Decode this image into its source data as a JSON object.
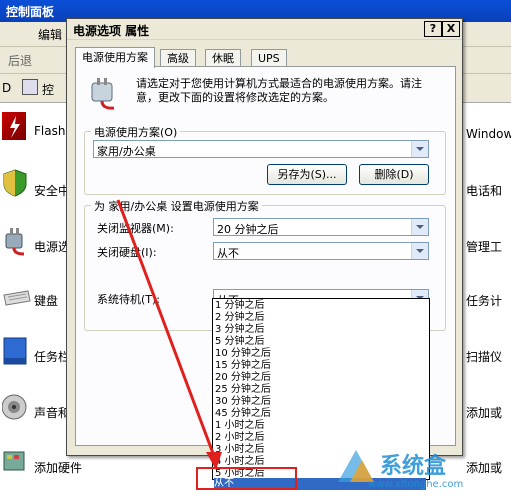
{
  "control_panel": {
    "window_title": "控制面板",
    "menu_partial": "编辑",
    "back_label": "后退",
    "address_partial": "控",
    "address_prefix": "D",
    "left_items": [
      {
        "label": "Flash H",
        "icon": "flash-icon"
      },
      {
        "label": "安全中",
        "icon": "security-shield-icon"
      },
      {
        "label": "电源选",
        "icon": "power-plug-icon"
      },
      {
        "label": "键盘",
        "icon": "keyboard-icon"
      },
      {
        "label": "任务栏",
        "icon": "taskbar-icon"
      },
      {
        "label": "声音和",
        "icon": "speaker-icon"
      },
      {
        "label": "添加硬件",
        "icon": "hardware-icon"
      }
    ],
    "right_items": [
      "Window",
      "电话和",
      "管理工",
      "任务计",
      "扫描仪",
      "添加或",
      "添加或"
    ]
  },
  "dialog": {
    "title": "电源选项 属性",
    "help_button": "?",
    "close_button": "X",
    "tabs": [
      "电源使用方案",
      "高级",
      "休眠",
      "UPS"
    ],
    "description": "请选定对于您使用计算机方式最适合的电源使用方案。请注意，更改下面的设置将修改选定的方案。",
    "scheme_group_label": "电源使用方案(O)",
    "scheme_value": "家用/办公桌",
    "save_as_button": "另存为(S)...",
    "delete_button": "删除(D)",
    "settings_group_label": "为 家用/办公桌 设置电源使用方案",
    "monitor_label": "关闭监视器(M):",
    "monitor_value": "20 分钟之后",
    "harddisk_label": "关闭硬盘(I):",
    "harddisk_value": "从不",
    "standby_label": "系统待机(T):",
    "standby_value": "从不"
  },
  "dropdown": {
    "options": [
      "1 分钟之后",
      "2 分钟之后",
      "3 分钟之后",
      "5 分钟之后",
      "10 分钟之后",
      "15 分钟之后",
      "20 分钟之后",
      "25 分钟之后",
      "30 分钟之后",
      "45 分钟之后",
      "1 小时之后",
      "2 小时之后",
      "3 小时之后",
      "4 小时之后",
      "5 小时之后",
      "从不"
    ],
    "selected": "从不"
  },
  "watermark": {
    "text": "系统盒",
    "url": "www.xitonghe.com"
  },
  "colors": {
    "annotation_red": "#e0201c",
    "selection_blue": "#316ac5"
  }
}
